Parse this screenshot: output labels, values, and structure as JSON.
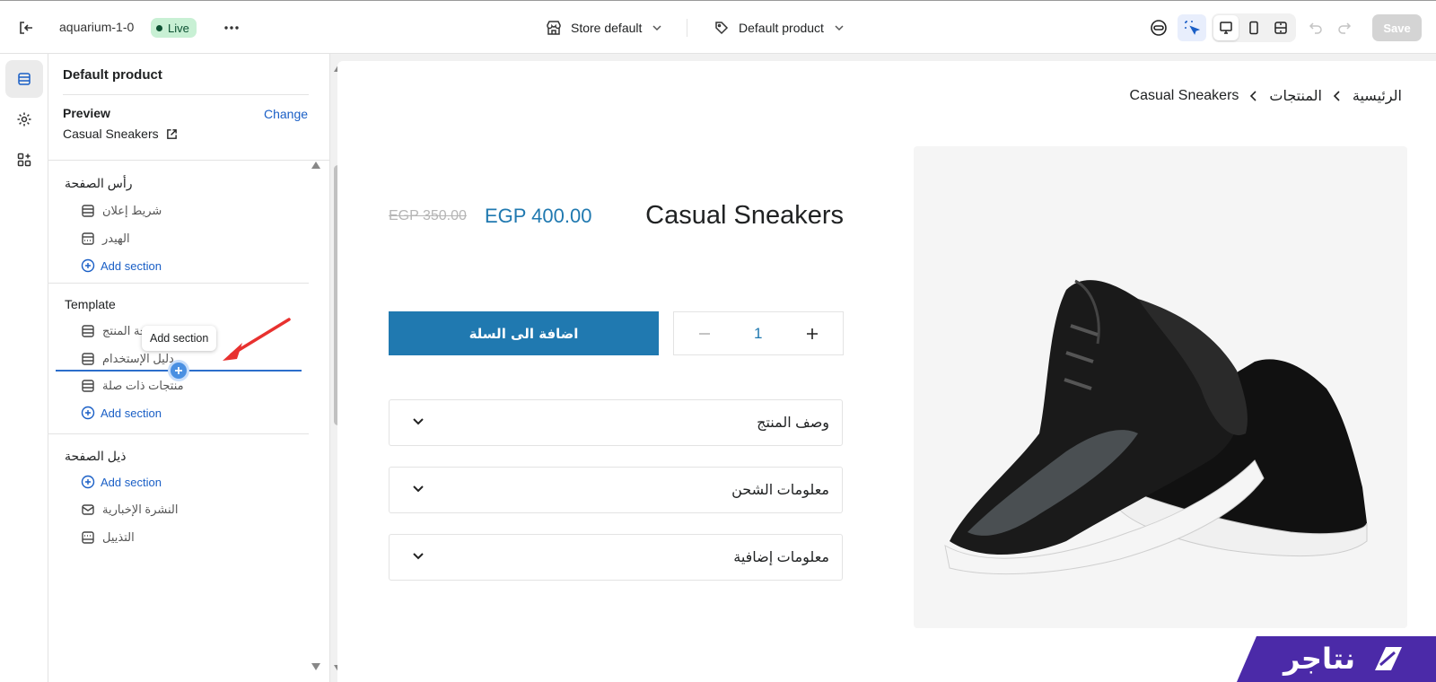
{
  "topbar": {
    "store_name": "aquarium-1-0",
    "live_badge": "Live",
    "store_select": "Store default",
    "template_select": "Default product",
    "save_label": "Save"
  },
  "panel": {
    "title": "Default product",
    "preview_label": "Preview",
    "change_link": "Change",
    "preview_product": "Casual Sneakers",
    "header_group": {
      "title": "رأس الصفحة",
      "items": [
        "شريط إعلان",
        "الهيدر"
      ],
      "add_label": "Add section"
    },
    "template_group": {
      "title": "Template",
      "items": [
        "صفحة المنتج",
        "دليل الإستخدام",
        "منتجات ذات صلة"
      ],
      "add_label": "Add section"
    },
    "footer_group": {
      "title": "ذيل الصفحة",
      "add_label": "Add section",
      "items": [
        "النشرة الإخبارية",
        "التذييل"
      ]
    },
    "tooltip": "Add section"
  },
  "preview": {
    "breadcrumb": [
      "الرئيسية",
      "المنتجات",
      "Casual Sneakers"
    ],
    "product_title": "Casual Sneakers",
    "price": "EGP 400.00",
    "compare_price": "EGP 350.00",
    "add_to_cart": "اضافة الى السلة",
    "quantity": "1",
    "accordions": [
      "وصف المنتج",
      "معلومات الشحن",
      "معلومات إضافية"
    ]
  },
  "brand": {
    "logo_text": "نتاجر"
  },
  "colors": {
    "accent": "#2079b0",
    "link": "#1a5fc6",
    "live_bg": "#c8f0d4",
    "brand_purple": "#4b2aa8"
  }
}
